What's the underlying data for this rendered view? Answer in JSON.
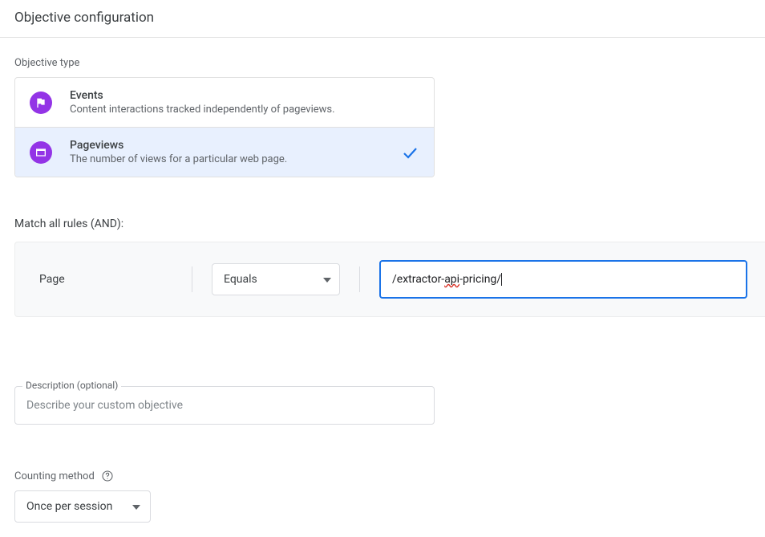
{
  "header": {
    "title": "Objective configuration"
  },
  "objective_type": {
    "label": "Objective type",
    "options": [
      {
        "title": "Events",
        "desc": "Content interactions tracked independently of pageviews.",
        "selected": false
      },
      {
        "title": "Pageviews",
        "desc": "The number of views for a particular web page.",
        "selected": true
      }
    ]
  },
  "match_rules": {
    "label": "Match all rules (AND):",
    "rule": {
      "field_label": "Page",
      "operator": "Equals",
      "value_prefix": "/extractor-",
      "value_spell": "api",
      "value_suffix": "-pricing/"
    }
  },
  "description": {
    "legend": "Description (optional)",
    "placeholder": "Describe your custom objective"
  },
  "counting": {
    "label": "Counting method",
    "value": "Once per session"
  }
}
